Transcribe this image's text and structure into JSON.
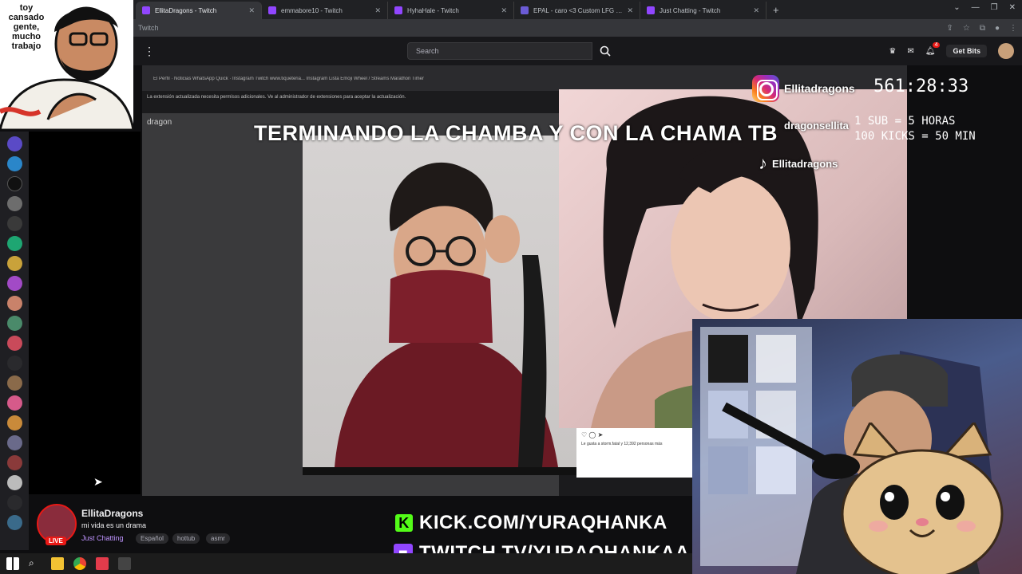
{
  "browser": {
    "tabs": [
      {
        "title": "EllitaDragons - Twitch",
        "active": true
      },
      {
        "title": "emmabore10 - Twitch"
      },
      {
        "title": "HyhaHale - Twitch"
      },
      {
        "title": "EPAL - caro <3 Custom LFG Lo..."
      },
      {
        "title": "Just Chatting - Twitch"
      }
    ],
    "new_tab": "+",
    "address_text": "Twitch"
  },
  "twitch_nav": {
    "search_placeholder": "Search",
    "get_bits": "Get Bits",
    "notification_count": "4"
  },
  "meme": {
    "caption": "toy cansado gente, mucho trabajo"
  },
  "capture": {
    "note": "La extensión actualizada necesita permisos adicionales. Ve al administrador de extensiones para aceptar la actualización.",
    "heading": "dragon",
    "bookmarks": "El Perfil · Noticias   WhatsApp   Quick · Instagram   Twitch   www.tiqueteria...   Instagram   Lista Emoji   Wheel / Streams   Marathon Timer"
  },
  "overlay": {
    "headline": "TERMINANDO LA CHAMBA Y CON LA CHAMA TB",
    "timer": "561:28:33",
    "rules": [
      "1 SUB = 5 HORAS",
      "100 KICKS = 50 MIN"
    ],
    "instagram_handle": "Ellitadragons",
    "second_handle": "dragonsellita",
    "tiktok_handle": "Ellitadragons"
  },
  "instagram_panel": {
    "text": "Le gusta a storm.fatal y 12,392 personas más"
  },
  "channel": {
    "name": "EllitaDragons",
    "title": "mi vida es un drama",
    "category": "Just Chatting",
    "tags": [
      "Español",
      "hottub",
      "asmr"
    ],
    "live": "LIVE"
  },
  "links": {
    "kick": "KICK.COM/YURAQHANKA",
    "twitch": "TWITCH.TV/YURAQHANKAA"
  }
}
